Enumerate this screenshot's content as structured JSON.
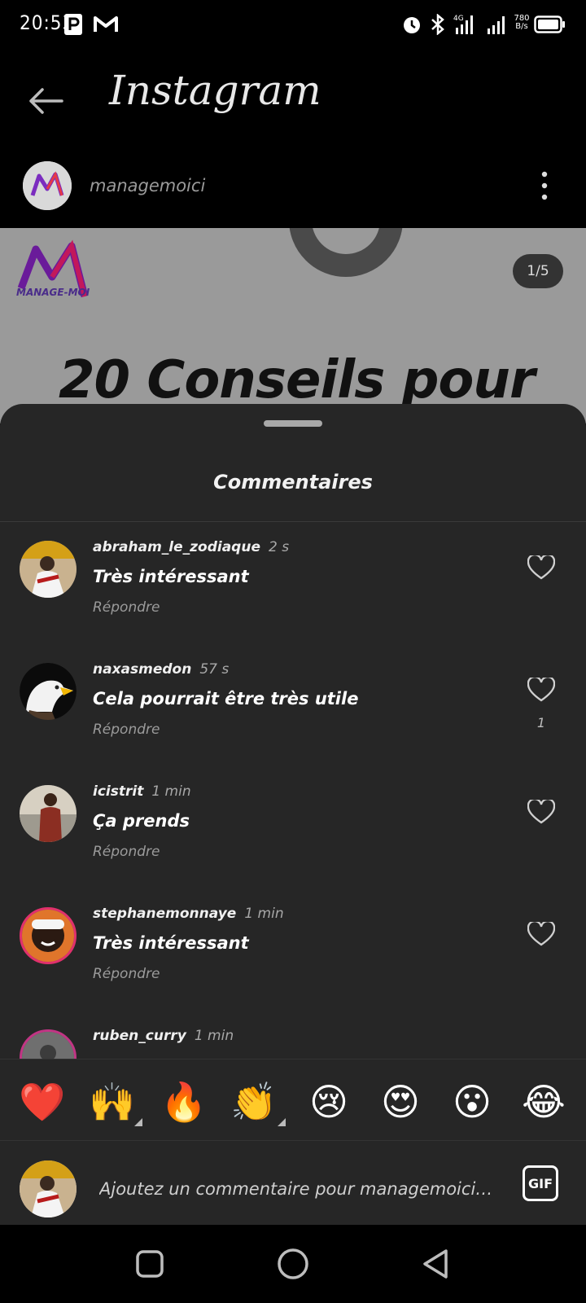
{
  "status_bar": {
    "time": "20:53",
    "network": "4G",
    "net_speed_value": "780",
    "net_speed_unit": "B/s"
  },
  "header": {
    "title": "Instagram",
    "username": "managemoici"
  },
  "post": {
    "brand": "MANAGE-MOI",
    "page_indicator": "1/5",
    "headline": "20 Conseils pour"
  },
  "comments_sheet": {
    "title": "Commentaires",
    "comments": [
      {
        "username": "abraham_le_zodiaque",
        "time": "2 s",
        "text": "Très intéressant",
        "reply_label": "Répondre",
        "likes": ""
      },
      {
        "username": "naxasmedon",
        "time": "57 s",
        "text": "Cela pourrait être très utile",
        "reply_label": "Répondre",
        "likes": "1"
      },
      {
        "username": "icistrit",
        "time": "1 min",
        "text": "Ça prends",
        "reply_label": "Répondre",
        "likes": ""
      },
      {
        "username": "stephanemonnaye",
        "time": "1 min",
        "text": "Très intéressant",
        "reply_label": "Répondre",
        "likes": ""
      },
      {
        "username": "ruben_curry",
        "time": "1 min",
        "text": "",
        "reply_label": "",
        "likes": ""
      }
    ]
  },
  "emoji_bar": [
    "❤️",
    "🙌",
    "🔥",
    "👏",
    "😢",
    "😍",
    "😮",
    "😂"
  ],
  "comment_input": {
    "placeholder": "Ajoutez un commentaire pour managemoici…",
    "gif_label": "GIF"
  },
  "colors": {
    "sheet_bg": "#262626",
    "accent_ring": "#e1306c"
  }
}
